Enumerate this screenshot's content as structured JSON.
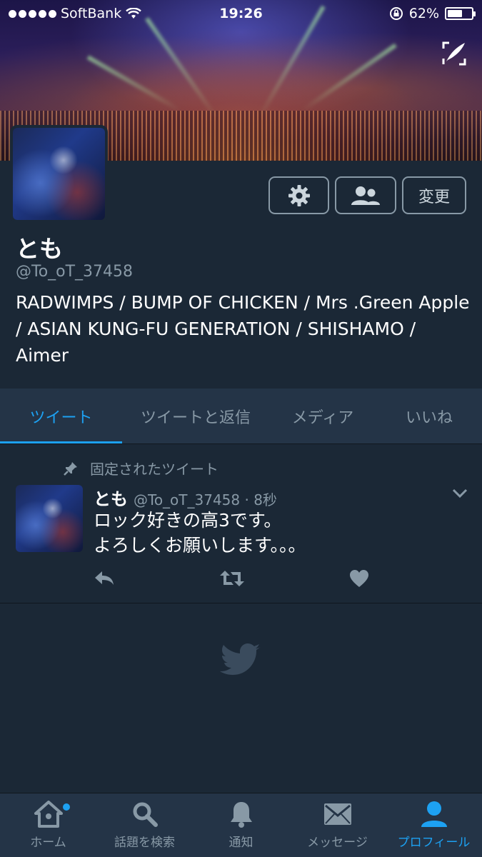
{
  "status_bar": {
    "carrier": "SoftBank",
    "time": "19:26",
    "battery": "62%",
    "battery_level": 0.62
  },
  "profile": {
    "name": "とも",
    "handle": "@To_oT_37458",
    "bio": "RADWIMPS / BUMP OF CHICKEN / Mrs .Green Apple / ASIAN KUNG-FU GENERATION / SHISHAMO / Aimer",
    "edit_label": "変更"
  },
  "tabs": [
    {
      "label": "ツイート",
      "active": true
    },
    {
      "label": "ツイートと返信",
      "active": false
    },
    {
      "label": "メディア",
      "active": false
    },
    {
      "label": "いいね",
      "active": false
    }
  ],
  "tweet": {
    "pinned_label": "固定されたツイート",
    "name": "とも",
    "meta": "@To_oT_37458 · 8秒",
    "line1": "ロック好きの高3です。",
    "line2": "よろしくお願いします。。。"
  },
  "bottom_nav": [
    {
      "label": "ホーム",
      "icon": "home-icon",
      "active": false
    },
    {
      "label": "話題を検索",
      "icon": "search-icon",
      "active": false
    },
    {
      "label": "通知",
      "icon": "bell-icon",
      "active": false
    },
    {
      "label": "メッセージ",
      "icon": "envelope-icon",
      "active": false
    },
    {
      "label": "プロフィール",
      "icon": "person-icon",
      "active": true
    }
  ],
  "colors": {
    "background": "#1b2836",
    "panel": "#243447",
    "accent": "#1da1f2",
    "muted": "#8899a6"
  }
}
